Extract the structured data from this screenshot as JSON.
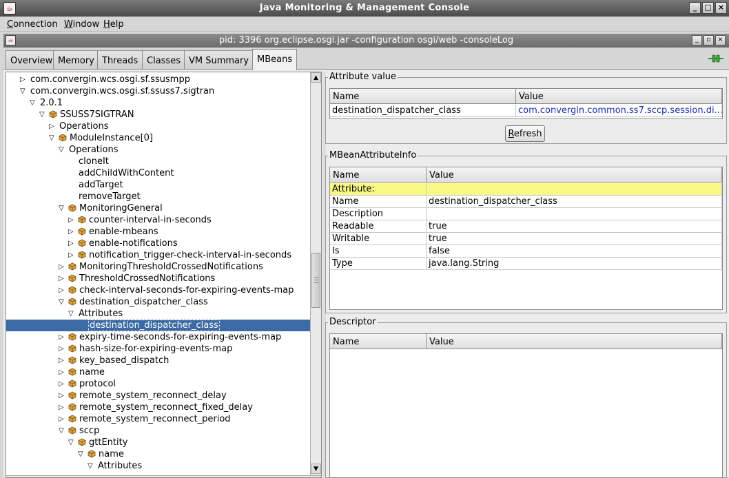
{
  "window": {
    "title": "Java Monitoring & Management Console"
  },
  "menubar": [
    {
      "first": "C",
      "rest": "onnection"
    },
    {
      "first": "W",
      "rest": "indow"
    },
    {
      "first": "H",
      "rest": "elp"
    }
  ],
  "internal_frame": {
    "title": "pid: 3396 org.eclipse.osgi.jar -configuration osgi/web -consoleLog"
  },
  "tabs": [
    "Overview",
    "Memory",
    "Threads",
    "Classes",
    "VM Summary",
    "MBeans"
  ],
  "active_tab": "MBeans",
  "tree": [
    {
      "label": "com.convergin.wcs.osgi.sf.ssusmpp",
      "expander": "collapsed",
      "bean": false
    },
    {
      "label": "com.convergin.wcs.osgi.sf.ssuss7.sigtran",
      "expander": "expanded",
      "bean": false
    },
    {
      "label": "2.0.1",
      "expander": "expanded",
      "bean": false
    },
    {
      "label": "SSUSS7SIGTRAN",
      "expander": "expanded",
      "bean": true
    },
    {
      "label": "Operations",
      "expander": "collapsed",
      "bean": false
    },
    {
      "label": "ModuleInstance[0]",
      "expander": "expanded",
      "bean": true
    },
    {
      "label": "Operations",
      "expander": "expanded",
      "bean": false
    },
    {
      "label": "cloneIt",
      "expander": "none",
      "bean": false
    },
    {
      "label": "addChildWithContent",
      "expander": "none",
      "bean": false
    },
    {
      "label": "addTarget",
      "expander": "none",
      "bean": false
    },
    {
      "label": "removeTarget",
      "expander": "none",
      "bean": false
    },
    {
      "label": "MonitoringGeneral",
      "expander": "expanded",
      "bean": true
    },
    {
      "label": "counter-interval-in-seconds",
      "expander": "collapsed",
      "bean": true
    },
    {
      "label": "enable-mbeans",
      "expander": "collapsed",
      "bean": true
    },
    {
      "label": "enable-notifications",
      "expander": "collapsed",
      "bean": true
    },
    {
      "label": "notification_trigger-check-interval-in-seconds",
      "expander": "collapsed",
      "bean": true
    },
    {
      "label": "MonitoringThresholdCrossedNotifications",
      "expander": "collapsed",
      "bean": true
    },
    {
      "label": "ThresholdCrossedNotifications",
      "expander": "collapsed",
      "bean": true
    },
    {
      "label": "check-interval-seconds-for-expiring-events-map",
      "expander": "collapsed",
      "bean": true
    },
    {
      "label": "destination_dispatcher_class",
      "expander": "expanded",
      "bean": true
    },
    {
      "label": "Attributes",
      "expander": "expanded",
      "bean": false
    },
    {
      "label": "destination_dispatcher_class",
      "expander": "none",
      "bean": false,
      "selected": true
    },
    {
      "label": "expiry-time-seconds-for-expiring-events-map",
      "expander": "collapsed",
      "bean": true
    },
    {
      "label": "hash-size-for-expiring-events-map",
      "expander": "collapsed",
      "bean": true
    },
    {
      "label": "key_based_dispatch",
      "expander": "collapsed",
      "bean": true
    },
    {
      "label": "name",
      "expander": "collapsed",
      "bean": true
    },
    {
      "label": "protocol",
      "expander": "collapsed",
      "bean": true
    },
    {
      "label": "remote_system_reconnect_delay",
      "expander": "collapsed",
      "bean": true
    },
    {
      "label": "remote_system_reconnect_fixed_delay",
      "expander": "collapsed",
      "bean": true
    },
    {
      "label": "remote_system_reconnect_period",
      "expander": "collapsed",
      "bean": true
    },
    {
      "label": "sccp",
      "expander": "expanded",
      "bean": true
    },
    {
      "label": "gttEntity",
      "expander": "expanded",
      "bean": true
    },
    {
      "label": "name",
      "expander": "expanded",
      "bean": true
    },
    {
      "label": "Attributes",
      "expander": "expanded",
      "bean": false
    }
  ],
  "attribute_value": {
    "title": "Attribute value",
    "headers": [
      "Name",
      "Value"
    ],
    "rows": [
      [
        "destination_dispatcher_class",
        "com.convergin.common.ss7.sccp.session.di..."
      ]
    ],
    "refresh": {
      "first": "R",
      "rest": "efresh"
    }
  },
  "mbean_info": {
    "title": "MBeanAttributeInfo",
    "headers": [
      "Name",
      "Value"
    ],
    "rows": [
      [
        "Attribute:",
        ""
      ],
      [
        "Name",
        "destination_dispatcher_class"
      ],
      [
        "Description",
        ""
      ],
      [
        "Readable",
        "true"
      ],
      [
        "Writable",
        "true"
      ],
      [
        "Is",
        "false"
      ],
      [
        "Type",
        "java.lang.String"
      ]
    ]
  },
  "descriptor": {
    "title": "Descriptor",
    "headers": [
      "Name",
      "Value"
    ]
  },
  "colors": {
    "selection": "#3b6aa5",
    "highlight_row": "#f8f884",
    "link": "#1a2fb0"
  },
  "icons": {
    "window_controls": [
      "minimize-icon",
      "maximize-icon",
      "close-icon"
    ],
    "connection_status": "plug-connected-icon"
  }
}
